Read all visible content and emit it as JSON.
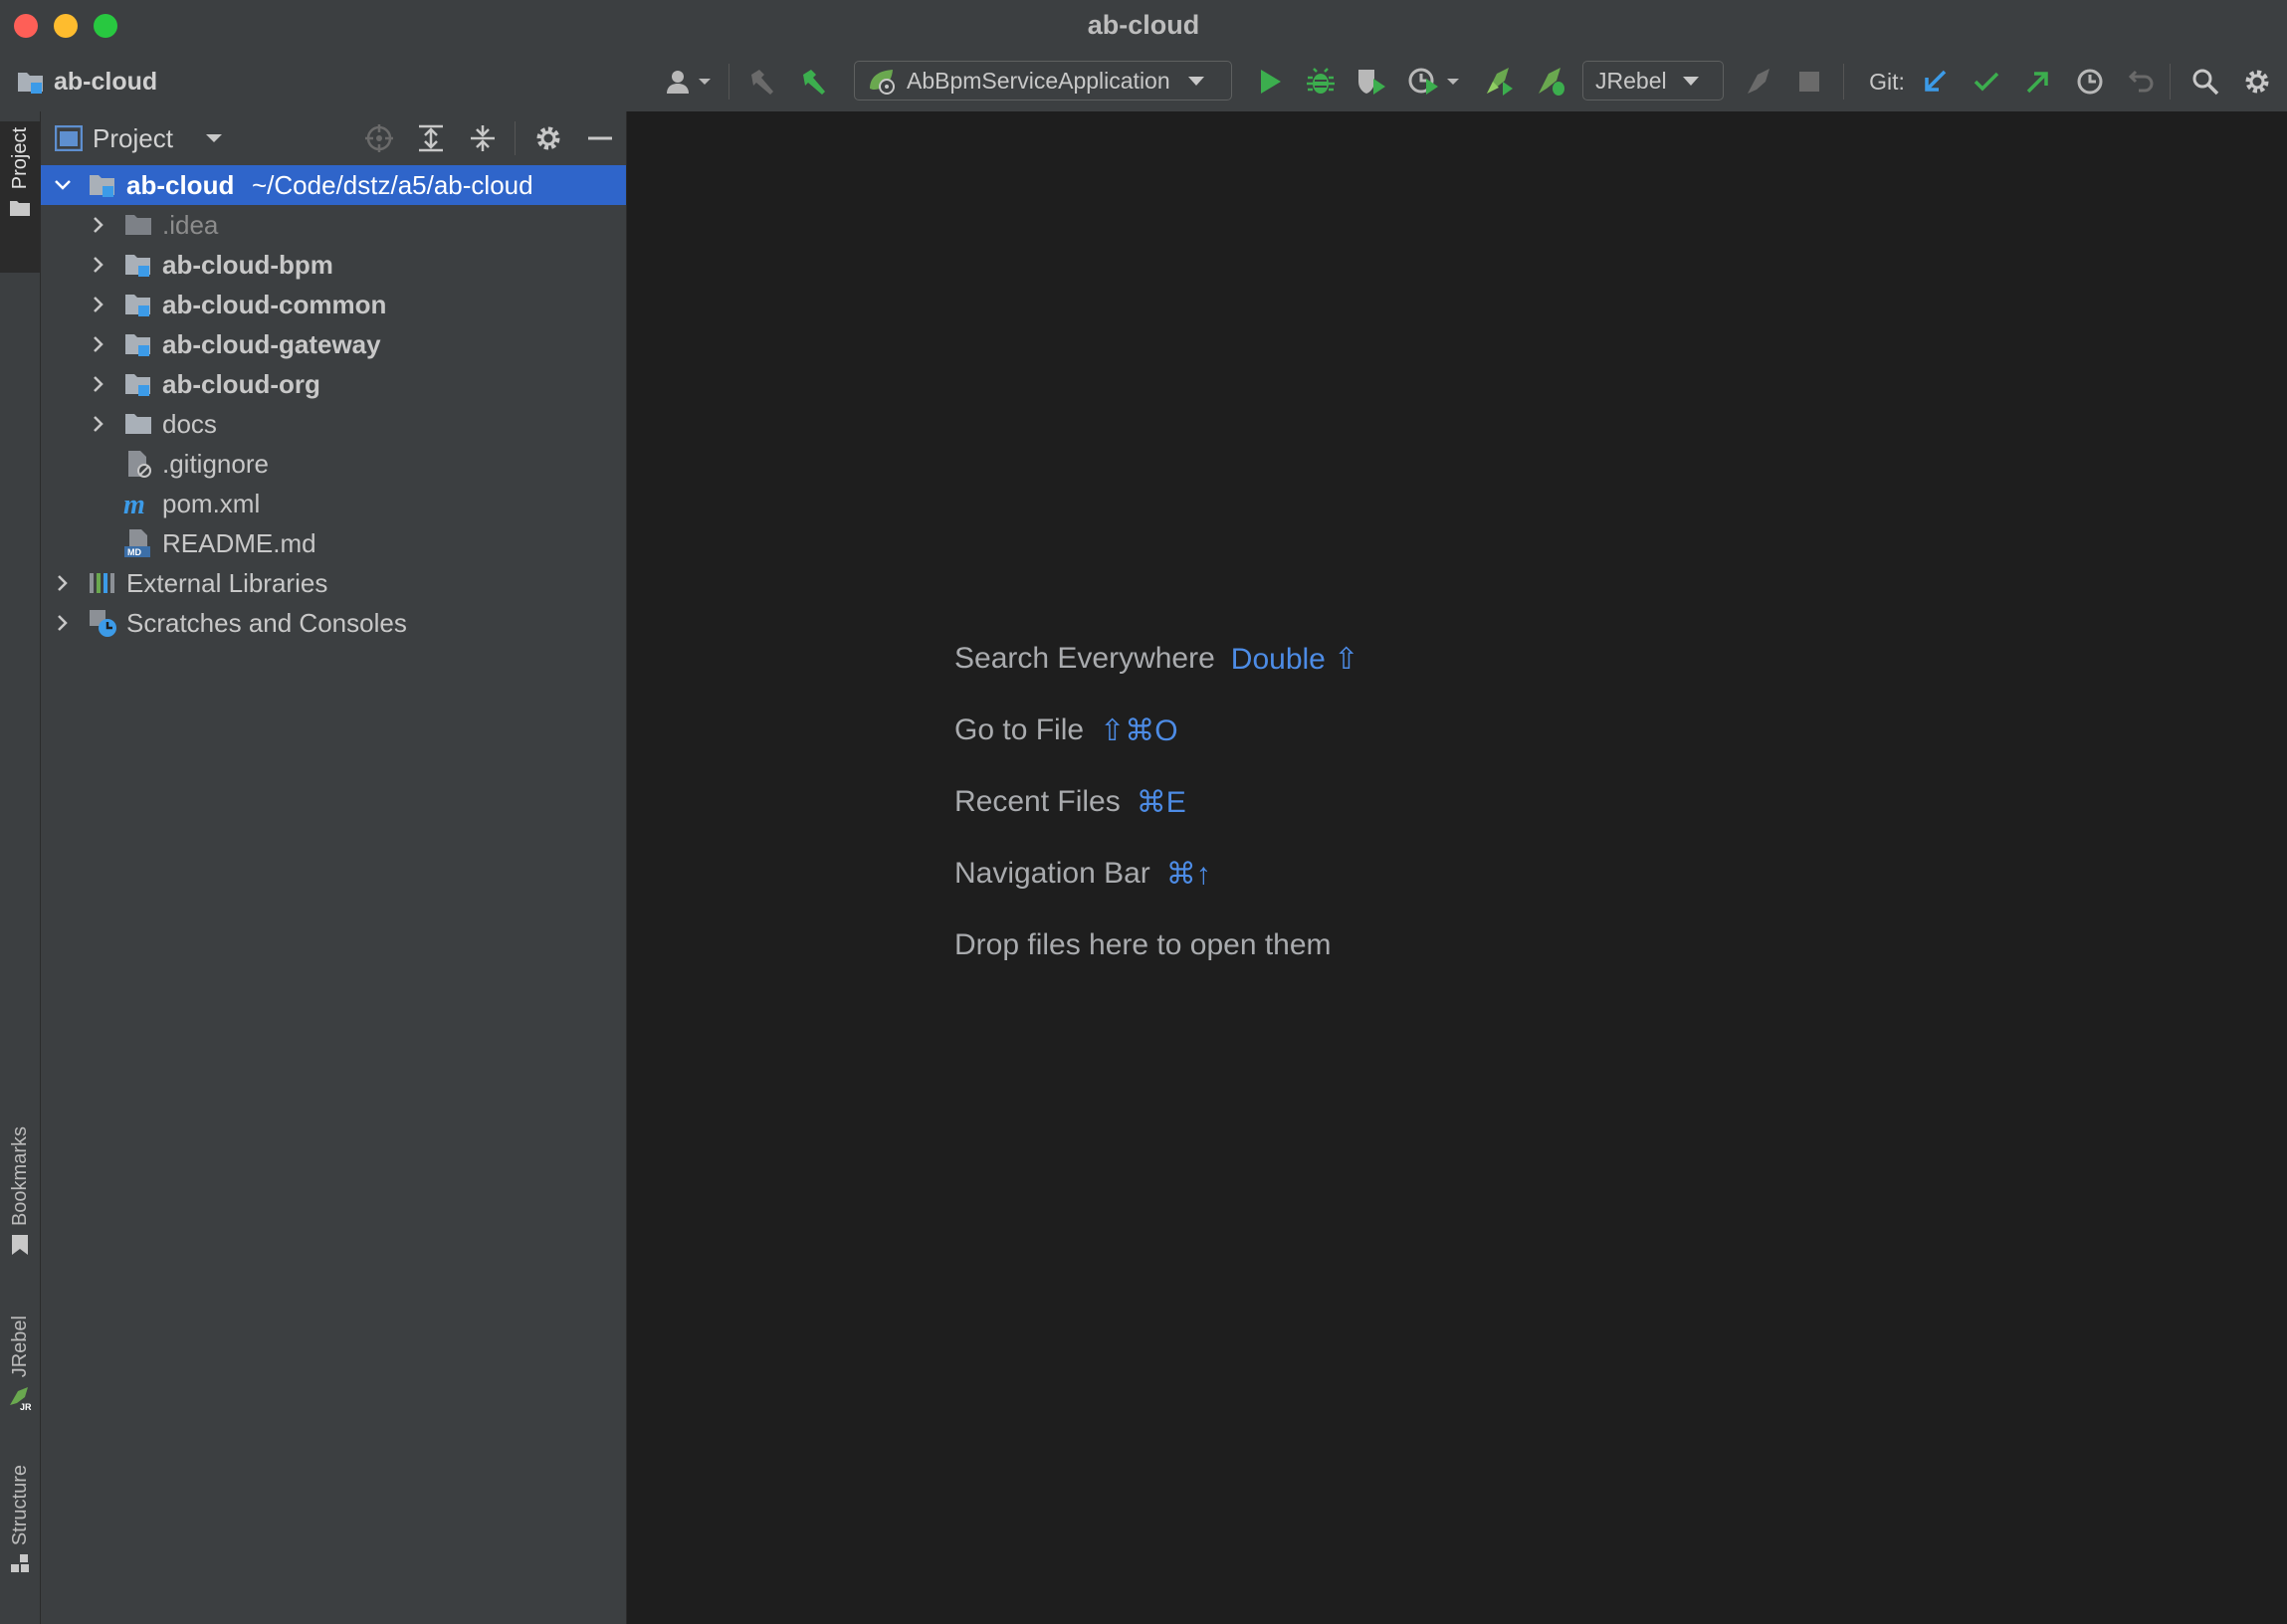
{
  "window": {
    "title": "ab-cloud"
  },
  "toolbar": {
    "breadcrumb": "ab-cloud",
    "run_config": "AbBpmServiceApplication",
    "jrebel_config": "JRebel",
    "git_label": "Git:"
  },
  "side_stripe": {
    "project_tab": "Project",
    "bookmarks_tab": "Bookmarks",
    "jrebel_tab": "JRebel",
    "structure_tab": "Structure"
  },
  "project_panel": {
    "title": "Project",
    "root": {
      "name": "ab-cloud",
      "path": "~/Code/dstz/a5/ab-cloud"
    },
    "items": [
      {
        "label": ".idea"
      },
      {
        "label": "ab-cloud-bpm"
      },
      {
        "label": "ab-cloud-common"
      },
      {
        "label": "ab-cloud-gateway"
      },
      {
        "label": "ab-cloud-org"
      },
      {
        "label": "docs"
      },
      {
        "label": ".gitignore"
      },
      {
        "label": "pom.xml"
      },
      {
        "label": "README.md"
      },
      {
        "label": "External Libraries"
      },
      {
        "label": "Scratches and Consoles"
      }
    ]
  },
  "editor": {
    "hints": [
      {
        "text": "Search Everywhere",
        "shortcut": "Double ⇧"
      },
      {
        "text": "Go to File",
        "shortcut": "⇧⌘O"
      },
      {
        "text": "Recent Files",
        "shortcut": "⌘E"
      },
      {
        "text": "Navigation Bar",
        "shortcut": "⌘↑"
      },
      {
        "text": "Drop files here to open them",
        "shortcut": ""
      }
    ]
  },
  "colors": {
    "accent": "#2f65ca",
    "run_green": "#3cae4e",
    "link_blue": "#4d8ce6"
  }
}
